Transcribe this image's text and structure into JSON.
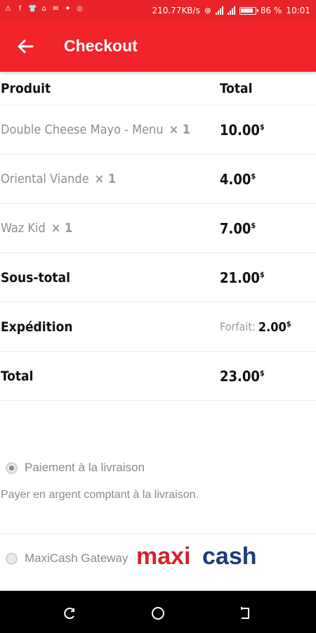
{
  "status_bar": {
    "network_speed": "210.77KB/s",
    "battery": "86 %",
    "time": "10:01"
  },
  "app_bar": {
    "title": "Checkout"
  },
  "order": {
    "header": {
      "product": "Produit",
      "total": "Total"
    },
    "items": [
      {
        "name": "Double Cheese Mayo - Menu",
        "qty": "× 1",
        "price": "10.00",
        "currency": "$"
      },
      {
        "name": "Oriental Viande",
        "qty": "× 1",
        "price": "4.00",
        "currency": "$"
      },
      {
        "name": "Waz Kid",
        "qty": "× 1",
        "price": "7.00",
        "currency": "$"
      }
    ],
    "subtotal": {
      "label": "Sous-total",
      "price": "21.00",
      "currency": "$"
    },
    "shipping": {
      "label": "Expédition",
      "method": "Forfait:",
      "price": "2.00",
      "currency": "$"
    },
    "total": {
      "label": "Total",
      "price": "23.00",
      "currency": "$"
    }
  },
  "payment": {
    "options": [
      {
        "label": "Paiement à la livraison",
        "description": "Payer en argent comptant à la livraison.",
        "selected": true
      },
      {
        "label": "MaxiCash Gateway",
        "logo_text_a": "maxi",
        "logo_text_b": "cash",
        "selected": false
      }
    ]
  },
  "colors": {
    "app_bar": "#f0242a",
    "status_bar": "#e8242a",
    "logo_maxi": "#d2232a",
    "logo_cash": "#1e3a78"
  }
}
